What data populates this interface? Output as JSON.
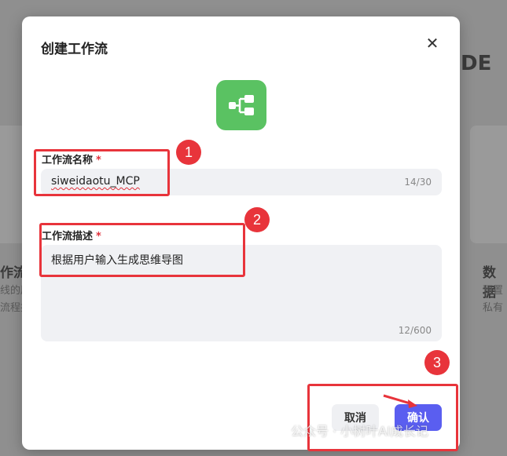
{
  "background": {
    "left_title": "作流",
    "left_lines": [
      "线的朋",
      "流程拄"
    ],
    "right_title": "数据",
    "right_lines": [
      "预置",
      "私有"
    ],
    "right_letters": "DE"
  },
  "modal": {
    "title": "创建工作流",
    "name_field": {
      "label": "工作流名称",
      "required": "*",
      "value": "siweidaotu_MCP",
      "counter": "14/30"
    },
    "description_field": {
      "label": "工作流描述",
      "required": "*",
      "value": "根据用户输入生成思维导图",
      "counter": "12/600"
    },
    "cancel_label": "取消",
    "confirm_label": "确认"
  },
  "annotations": [
    "1",
    "2",
    "3"
  ],
  "watermark": "公众号 · 小树叶AI成长记",
  "colors": {
    "accent": "#5a5ef0",
    "icon_bg": "#5ac262",
    "annotation": "#e8343b",
    "required": "#e0313b"
  }
}
